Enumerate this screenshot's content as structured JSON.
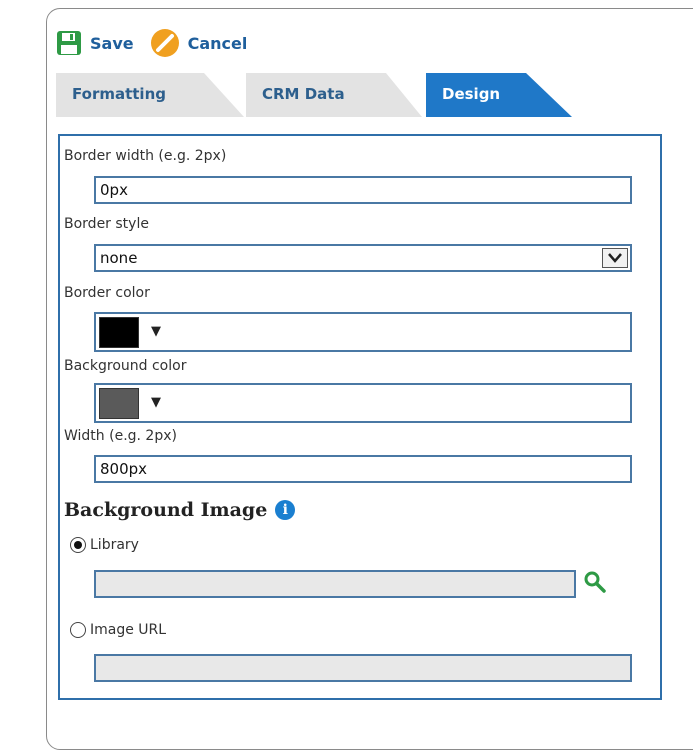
{
  "toolbar": {
    "save_label": "Save",
    "cancel_label": "Cancel"
  },
  "tabs": [
    {
      "label": "Formatting",
      "active": false
    },
    {
      "label": "CRM Data",
      "active": false
    },
    {
      "label": "Design",
      "active": true
    }
  ],
  "fields": {
    "border_width": {
      "label": "Border width (e.g. 2px)",
      "value": "0px"
    },
    "border_style": {
      "label": "Border style",
      "value": "none"
    },
    "border_color": {
      "label": "Border color",
      "swatch": "#000000"
    },
    "background_color": {
      "label": "Background color",
      "swatch": "#5a5a5a"
    },
    "width": {
      "label": "Width (e.g. 2px)",
      "value": "800px"
    }
  },
  "background_image": {
    "title": "Background Image",
    "library_label": "Library",
    "library_selected": true,
    "image_url_label": "Image URL",
    "image_url_selected": false
  },
  "colors": {
    "accent_blue": "#1f78c8",
    "save_green": "#2e9a45",
    "cancel_orange": "#f0a020"
  }
}
